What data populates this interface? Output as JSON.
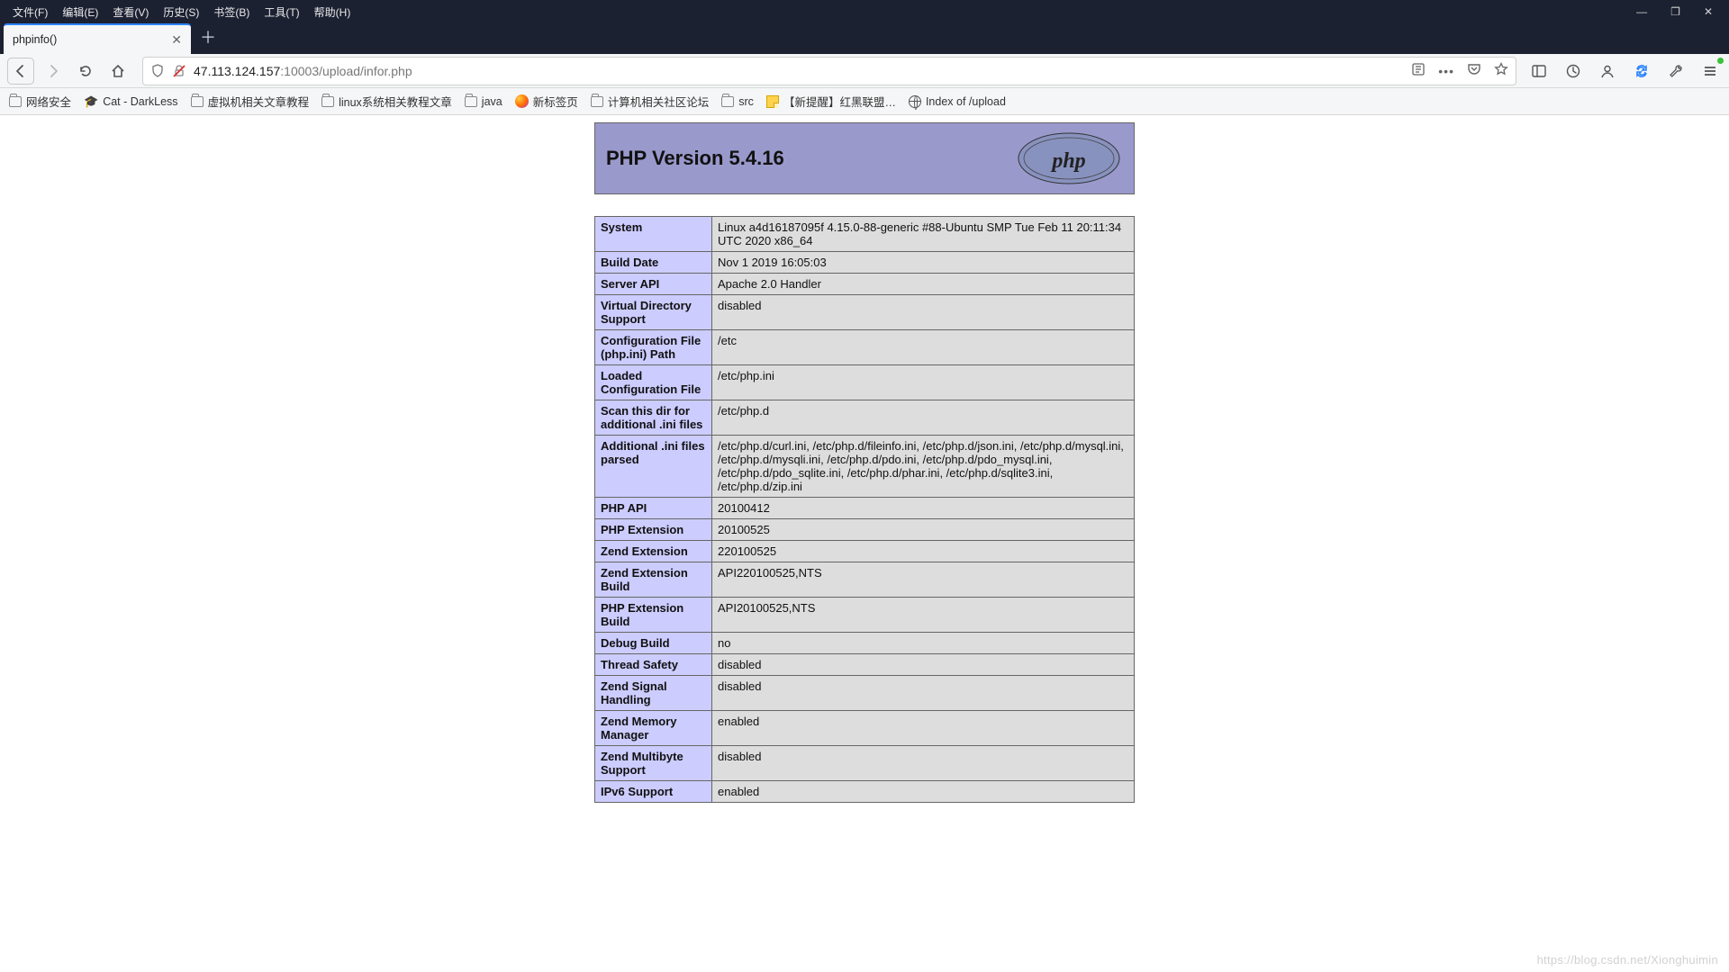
{
  "menu": {
    "items": [
      "文件(F)",
      "编辑(E)",
      "查看(V)",
      "历史(S)",
      "书签(B)",
      "工具(T)",
      "帮助(H)"
    ]
  },
  "window_controls": {
    "min": "—",
    "max": "❐",
    "close": "✕"
  },
  "tab": {
    "title": "phpinfo()",
    "close": "✕",
    "new": "＋"
  },
  "nav": {
    "url_host": "47.113.124.157",
    "url_rest": ":10003/upload/infor.php",
    "reader": "⧉",
    "dots": "•••",
    "pocket": "⌵",
    "star": "☆",
    "sidebar": "◫",
    "clock": "◷",
    "account": "◔",
    "sync": "⇆",
    "wrench": "🛠",
    "menu": "≡"
  },
  "bookmarks": [
    {
      "icon": "folder",
      "label": "网络安全"
    },
    {
      "icon": "grad",
      "label": "Cat - DarkLess"
    },
    {
      "icon": "folder",
      "label": "虚拟机相关文章教程"
    },
    {
      "icon": "folder",
      "label": "linux系统相关教程文章"
    },
    {
      "icon": "folder",
      "label": "java"
    },
    {
      "icon": "firefox",
      "label": "新标签页"
    },
    {
      "icon": "folder",
      "label": "计算机相关社区论坛"
    },
    {
      "icon": "folder",
      "label": "src"
    },
    {
      "icon": "note",
      "label": "【新提醒】红黑联盟…"
    },
    {
      "icon": "globe",
      "label": "Index of /upload"
    }
  ],
  "php": {
    "title": "PHP Version 5.4.16",
    "rows": [
      {
        "k": "System",
        "v": "Linux a4d16187095f 4.15.0-88-generic #88-Ubuntu SMP Tue Feb 11 20:11:34 UTC 2020 x86_64"
      },
      {
        "k": "Build Date",
        "v": "Nov 1 2019 16:05:03"
      },
      {
        "k": "Server API",
        "v": "Apache 2.0 Handler"
      },
      {
        "k": "Virtual Directory Support",
        "v": "disabled"
      },
      {
        "k": "Configuration File (php.ini) Path",
        "v": "/etc"
      },
      {
        "k": "Loaded Configuration File",
        "v": "/etc/php.ini"
      },
      {
        "k": "Scan this dir for additional .ini files",
        "v": "/etc/php.d"
      },
      {
        "k": "Additional .ini files parsed",
        "v": "/etc/php.d/curl.ini, /etc/php.d/fileinfo.ini, /etc/php.d/json.ini, /etc/php.d/mysql.ini, /etc/php.d/mysqli.ini, /etc/php.d/pdo.ini, /etc/php.d/pdo_mysql.ini, /etc/php.d/pdo_sqlite.ini, /etc/php.d/phar.ini, /etc/php.d/sqlite3.ini, /etc/php.d/zip.ini"
      },
      {
        "k": "PHP API",
        "v": "20100412"
      },
      {
        "k": "PHP Extension",
        "v": "20100525"
      },
      {
        "k": "Zend Extension",
        "v": "220100525"
      },
      {
        "k": "Zend Extension Build",
        "v": "API220100525,NTS"
      },
      {
        "k": "PHP Extension Build",
        "v": "API20100525,NTS"
      },
      {
        "k": "Debug Build",
        "v": "no"
      },
      {
        "k": "Thread Safety",
        "v": "disabled"
      },
      {
        "k": "Zend Signal Handling",
        "v": "disabled"
      },
      {
        "k": "Zend Memory Manager",
        "v": "enabled"
      },
      {
        "k": "Zend Multibyte Support",
        "v": "disabled"
      },
      {
        "k": "IPv6 Support",
        "v": "enabled"
      }
    ]
  },
  "watermark": "https://blog.csdn.net/Xionghuimin"
}
